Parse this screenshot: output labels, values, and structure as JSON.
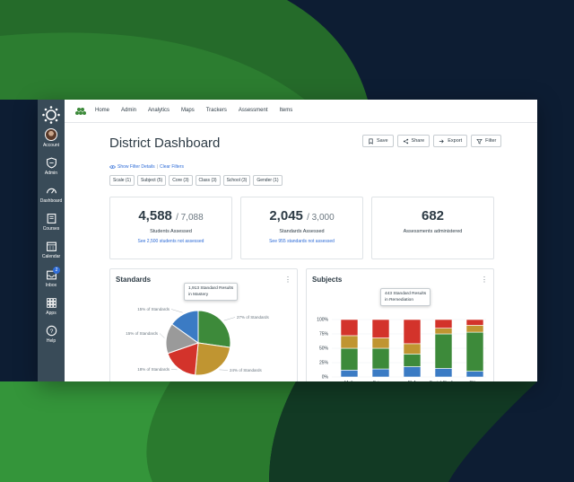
{
  "rail": {
    "items": [
      {
        "label": "Account",
        "icon": "avatar"
      },
      {
        "label": "Admin",
        "icon": "shield-icon"
      },
      {
        "label": "Dashboard",
        "icon": "dashboard-icon"
      },
      {
        "label": "Courses",
        "icon": "book-icon"
      },
      {
        "label": "Calendar",
        "icon": "calendar-icon"
      },
      {
        "label": "Inbox",
        "icon": "inbox-icon",
        "badge": "2"
      },
      {
        "label": "Apps",
        "icon": "grid-icon"
      },
      {
        "label": "Help",
        "icon": "help-icon"
      }
    ]
  },
  "nav": {
    "items": [
      "Home",
      "Admin",
      "Analytics",
      "Maps",
      "Trackers",
      "Assessment",
      "Items"
    ]
  },
  "page": {
    "title": "District Dashboard"
  },
  "actions": {
    "save": "Save",
    "share": "Share",
    "export": "Export",
    "filter": "Filter"
  },
  "filters": {
    "show_details": "Show Filter Details",
    "separator": "|",
    "clear": "Clear Filters",
    "chips": [
      "Scale (1)",
      "Subject (5)",
      "Core (3)",
      "Class (3)",
      "School (3)",
      "Gender (1)"
    ]
  },
  "kpis": [
    {
      "value": "4,588",
      "total": "/ 7,088",
      "label": "Students Assessed",
      "link": "See 2,500 students not assessed"
    },
    {
      "value": "2,045",
      "total": "/ 3,000",
      "label": "Standards Assessed",
      "link": "See 955 standards not assessed"
    },
    {
      "value": "682",
      "total": "",
      "label": "Assessments administered",
      "link": ""
    }
  ],
  "standards_card": {
    "title": "Standards",
    "menu": "⋮",
    "tooltip_line1": "1,913 Standard Results",
    "tooltip_line2": "in Mastery"
  },
  "subjects_card": {
    "title": "Subjects",
    "menu": "⋮",
    "tooltip_line1": "443 Standard Results",
    "tooltip_line2": "in Remediation"
  },
  "colors": {
    "blue": "#3b7bc4",
    "green": "#3d8a3a",
    "gold": "#c09531",
    "red": "#d3332b",
    "gray": "#9a9a9a",
    "accent": "#2d6bd7"
  },
  "chart_data": [
    {
      "type": "pie",
      "title": "Standards",
      "slices": [
        {
          "label": "27% of Standards",
          "value": 27,
          "color": "#3d8a3a"
        },
        {
          "label": "24% of Standards",
          "value": 24,
          "color": "#c09531"
        },
        {
          "label": "18% of Standards",
          "value": 18,
          "color": "#d3332b"
        },
        {
          "label": "15% of Standards",
          "value": 15,
          "color": "#9a9a9a"
        },
        {
          "label": "15% of Standards",
          "value": 15,
          "color": "#3b7bc4"
        }
      ]
    },
    {
      "type": "bar",
      "stacked": true,
      "title": "Subjects",
      "categories": [
        "Math",
        "Science",
        "ELA",
        "Social Studies",
        "Other"
      ],
      "yticks": [
        "0%",
        "25%",
        "50%",
        "75%",
        "100%"
      ],
      "ylim": [
        0,
        100
      ],
      "series": [
        {
          "color": "#3b7bc4",
          "values": [
            12,
            14,
            18,
            15,
            10
          ]
        },
        {
          "color": "#3d8a3a",
          "values": [
            38,
            36,
            22,
            60,
            68
          ]
        },
        {
          "color": "#c09531",
          "values": [
            22,
            18,
            18,
            10,
            12
          ]
        },
        {
          "color": "#d3332b",
          "values": [
            28,
            32,
            42,
            15,
            10
          ]
        }
      ]
    }
  ]
}
